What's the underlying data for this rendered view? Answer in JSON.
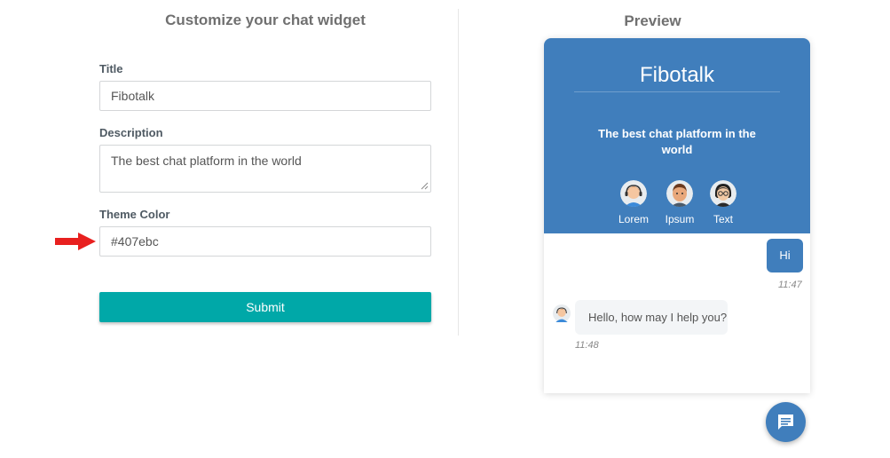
{
  "form": {
    "heading": "Customize your chat widget",
    "title_label": "Title",
    "title_value": "Fibotalk",
    "description_label": "Description",
    "description_value": "The best chat platform in the world",
    "theme_label": "Theme Color",
    "theme_value": "#407ebc",
    "submit_label": "Submit"
  },
  "preview": {
    "heading": "Preview",
    "widget_title": "Fibotalk",
    "widget_description": "The best chat platform in the world",
    "agents": [
      {
        "name": "Lorem",
        "icon": "agent-headset-icon"
      },
      {
        "name": "Ipsum",
        "icon": "agent-man-icon"
      },
      {
        "name": "Text",
        "icon": "agent-woman-glasses-icon"
      }
    ],
    "messages": [
      {
        "from": "user",
        "text": "Hi",
        "time": "11:47"
      },
      {
        "from": "agent",
        "text": "Hello, how may I help you?",
        "time": "11:48"
      }
    ],
    "launcher_icon": "chat-bubble-icon"
  },
  "colors": {
    "theme": "#407ebc",
    "submit": "#00a8a8",
    "arrow": "#e8201f"
  }
}
